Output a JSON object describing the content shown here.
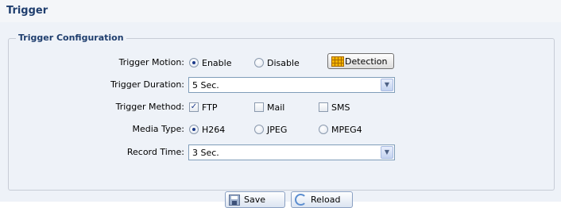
{
  "title": "Trigger",
  "section_title": "Trigger Configuration",
  "trigger_motion": {
    "label": "Trigger Motion:",
    "options": [
      "Enable",
      "Disable"
    ],
    "selected": "Enable",
    "detection_button": "Detection"
  },
  "trigger_duration": {
    "label": "Trigger Duration:",
    "value": "5 Sec."
  },
  "trigger_method": {
    "label": "Trigger Method:",
    "options": [
      {
        "label": "FTP",
        "checked": true
      },
      {
        "label": "Mail",
        "checked": false
      },
      {
        "label": "SMS",
        "checked": false
      }
    ]
  },
  "media_type": {
    "label": "Media Type:",
    "options": [
      "H264",
      "JPEG",
      "MPEG4"
    ],
    "selected": "H264"
  },
  "record_time": {
    "label": "Record Time:",
    "value": "3 Sec."
  },
  "buttons": {
    "save": "Save",
    "reload": "Reload"
  },
  "icons": {
    "detection": "grid-icon",
    "save": "disk-icon",
    "reload": "reload-icon",
    "dropdown": "chevron-down-icon"
  }
}
